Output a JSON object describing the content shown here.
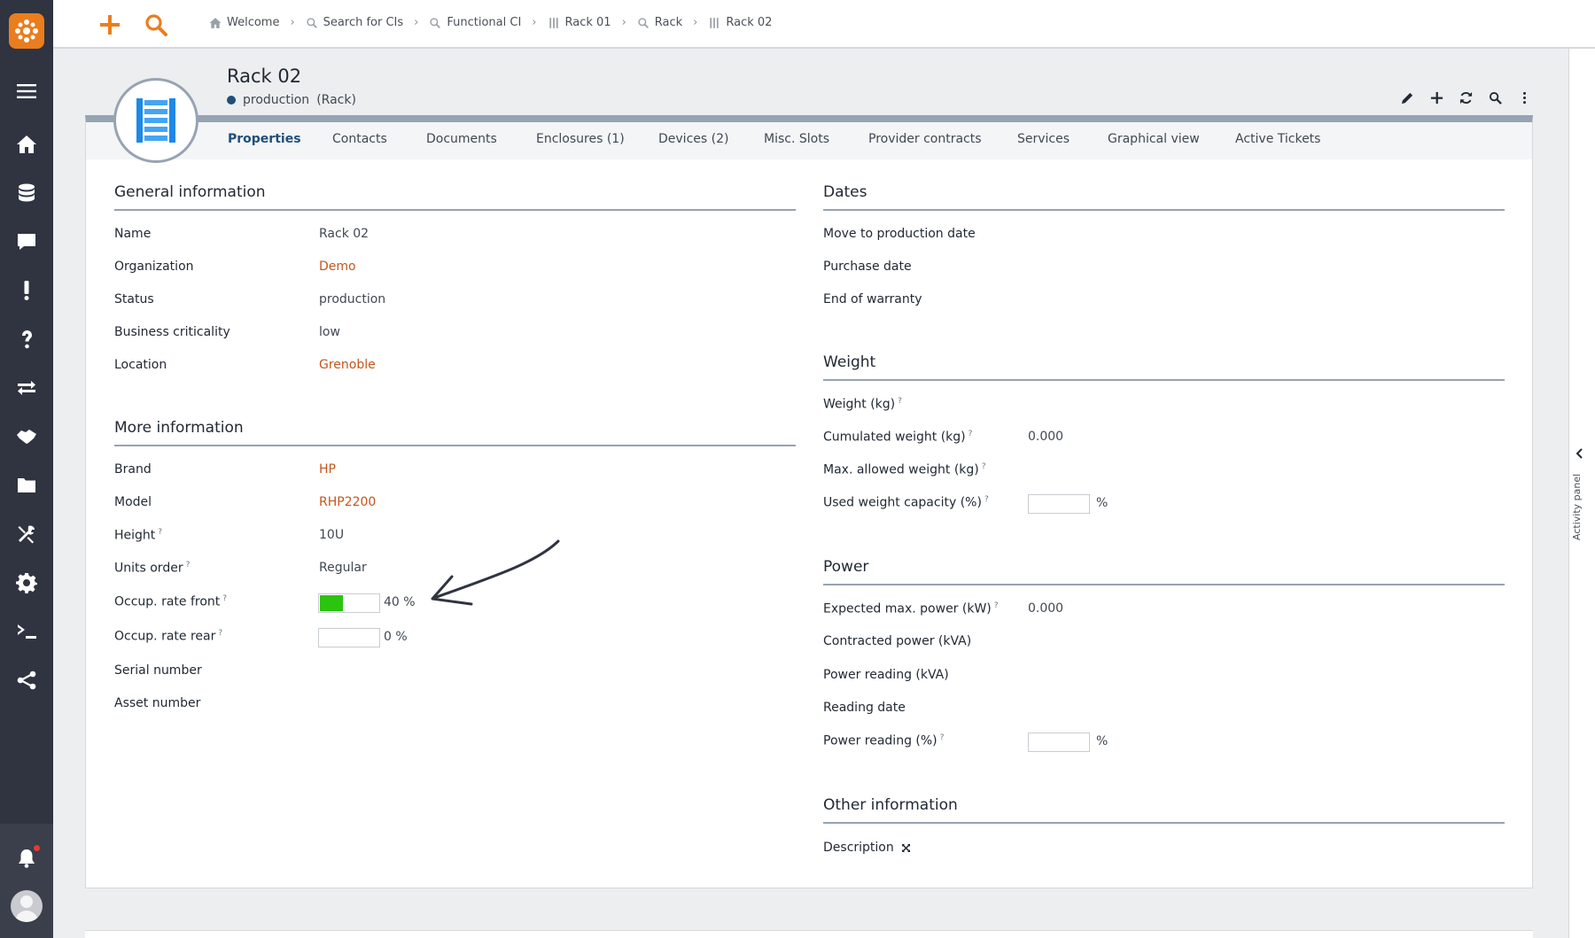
{
  "breadcrumb": {
    "items": [
      {
        "label": "Welcome",
        "icon": "home-icon"
      },
      {
        "label": "Search for CIs",
        "icon": "search-icon"
      },
      {
        "label": "Functional CI",
        "icon": "search-icon"
      },
      {
        "label": "Rack 01",
        "icon": "rack-icon"
      },
      {
        "label": "Rack",
        "icon": "search-icon"
      },
      {
        "label": "Rack 02",
        "icon": "rack-icon"
      }
    ]
  },
  "object": {
    "title": "Rack 02",
    "status": "production",
    "class": "(Rack)"
  },
  "tabs": [
    {
      "label": "Properties"
    },
    {
      "label": "Contacts"
    },
    {
      "label": "Documents"
    },
    {
      "label": "Enclosures (1)"
    },
    {
      "label": "Devices (2)"
    },
    {
      "label": "Misc. Slots"
    },
    {
      "label": "Provider contracts"
    },
    {
      "label": "Services"
    },
    {
      "label": "Graphical view"
    },
    {
      "label": "Active Tickets"
    }
  ],
  "general": {
    "title": "General information",
    "fields": [
      {
        "label": "Name",
        "value": "Rack 02"
      },
      {
        "label": "Organization",
        "value": "Demo"
      },
      {
        "label": "Status",
        "value": "production"
      },
      {
        "label": "Business criticality",
        "value": "low"
      },
      {
        "label": "Location",
        "value": "Grenoble"
      }
    ]
  },
  "more": {
    "title": "More information",
    "fields": [
      {
        "label": "Brand",
        "value": "HP"
      },
      {
        "label": "Model",
        "value": "RHP2200"
      },
      {
        "label": "Height",
        "value": "10U"
      },
      {
        "label": "Units order",
        "value": "Regular"
      },
      {
        "label": "Occup. rate front",
        "value": "40 %",
        "percent": 40
      },
      {
        "label": "Occup. rate rear",
        "value": "0 %",
        "percent": 0
      },
      {
        "label": "Serial number",
        "value": ""
      },
      {
        "label": "Asset number",
        "value": ""
      }
    ]
  },
  "dates": {
    "title": "Dates",
    "fields": [
      {
        "label": "Move to production date"
      },
      {
        "label": "Purchase date"
      },
      {
        "label": "End of warranty"
      }
    ]
  },
  "weight": {
    "title": "Weight",
    "fields": [
      {
        "label": "Weight (kg)",
        "value": ""
      },
      {
        "label": "Cumulated weight (kg)",
        "value": "0.000"
      },
      {
        "label": "Max. allowed weight (kg)",
        "value": ""
      },
      {
        "label": "Used weight capacity (%)",
        "value": "%"
      }
    ]
  },
  "power": {
    "title": "Power",
    "fields": [
      {
        "label": "Expected max. power (kW)",
        "value": "0.000"
      },
      {
        "label": "Contracted power (kVA)",
        "value": ""
      },
      {
        "label": "Power reading (kVA)",
        "value": ""
      },
      {
        "label": "Reading date",
        "value": ""
      },
      {
        "label": "Power reading (%)",
        "value": "%"
      }
    ]
  },
  "other": {
    "title": "Other information",
    "fields": [
      {
        "label": "Description"
      }
    ]
  },
  "help_mark": "?",
  "activity_panel": {
    "label": "Activity panel"
  },
  "colors": {
    "accent": "#ea7d1e",
    "link": "#c2561e",
    "sidebar": "#2f3440",
    "progress": "#2bc40f",
    "status_production": "#1f4f7a"
  }
}
